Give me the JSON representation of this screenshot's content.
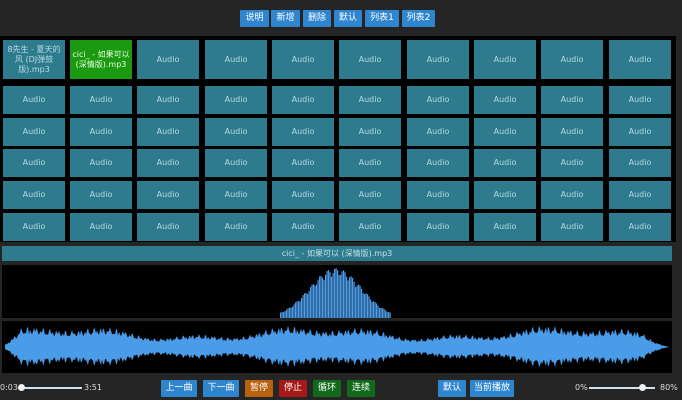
{
  "toolbar": {
    "buttons": [
      "说明",
      "新增",
      "删除",
      "默认",
      "列表1",
      "列表2"
    ]
  },
  "playlist": {
    "tiles": [
      "8先生 - 夏天的风 (DJ弹鼓版).mp3",
      "cici_ - 如果可以 (深情版).mp3",
      "Audio",
      "Audio",
      "Audio",
      "Audio",
      "Audio",
      "Audio",
      "Audio",
      "Audio",
      "Audio",
      "Audio",
      "Audio",
      "Audio",
      "Audio",
      "Audio",
      "Audio",
      "Audio",
      "Audio",
      "Audio",
      "Audio",
      "Audio",
      "Audio",
      "Audio",
      "Audio",
      "Audio",
      "Audio",
      "Audio",
      "Audio",
      "Audio",
      "Audio",
      "Audio",
      "Audio",
      "Audio",
      "Audio",
      "Audio",
      "Audio",
      "Audio",
      "Audio",
      "Audio",
      "Audio",
      "Audio",
      "Audio",
      "Audio",
      "Audio",
      "Audio",
      "Audio",
      "Audio",
      "Audio",
      "Audio",
      "Audio",
      "Audio",
      "Audio",
      "Audio",
      "Audio",
      "Audio",
      "Audio",
      "Audio",
      "Audio",
      "Audio"
    ],
    "active_index": 1
  },
  "now_playing": "cici_ - 如果可以 (深情版).mp3",
  "player": {
    "current_time": "0:03",
    "duration": "3:51",
    "progress": 0.02,
    "controls": [
      "上一曲",
      "下一曲",
      "暂停",
      "停止",
      "循环",
      "连续"
    ],
    "control_colors": [
      "blue",
      "blue",
      "orange",
      "red",
      "green",
      "green"
    ],
    "mode_buttons": [
      "默认",
      "当前播放"
    ],
    "volume_min": "0%",
    "volume_max": "80%",
    "volume": 0.8
  },
  "colors": {
    "tile": "#2e7b8e",
    "active_tile": "#1a9911",
    "wave": "#4a9be8"
  }
}
